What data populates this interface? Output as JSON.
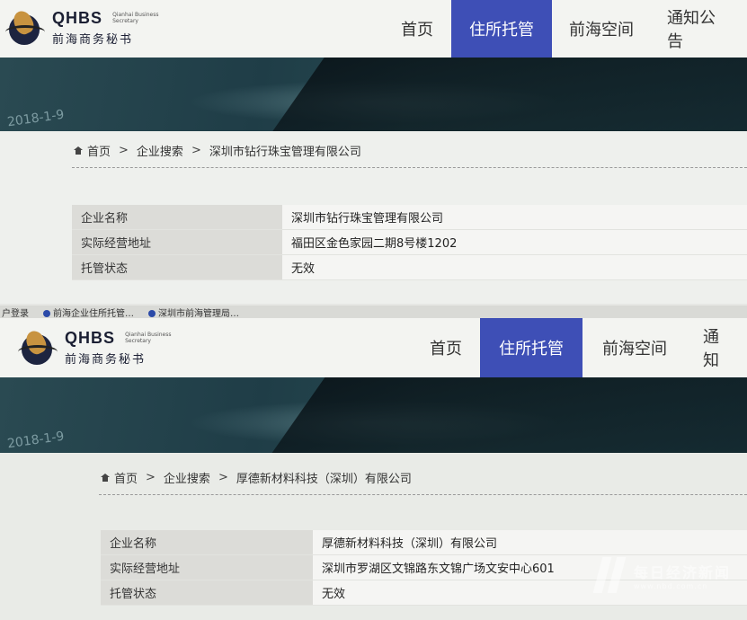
{
  "logo": {
    "main": "QHBS",
    "en": "Qianhai Business Secretary",
    "cn": "前海商务秘书"
  },
  "nav": {
    "home": "首页",
    "residence": "住所托管",
    "space": "前海空间",
    "notice_top": "通知公告",
    "notice_bottom": "通知"
  },
  "banner": {
    "scrawl": "2018-1-9"
  },
  "bookmarks": {
    "items": [
      "户登录",
      "前海企业住所托管…",
      "深圳市前海管理局…"
    ]
  },
  "top": {
    "breadcrumb": {
      "home": "首页",
      "search": "企业搜索",
      "current": "深圳市钻行珠宝管理有限公司"
    },
    "fields": [
      {
        "key": "企业名称",
        "value": "深圳市钻行珠宝管理有限公司"
      },
      {
        "key": "实际经营地址",
        "value": "福田区金色家园二期8号楼1202"
      },
      {
        "key": "托管状态",
        "value": "无效"
      }
    ]
  },
  "bottom": {
    "breadcrumb": {
      "home": "首页",
      "search": "企业搜索",
      "current": "厚德新材料科技（深圳）有限公司"
    },
    "fields": [
      {
        "key": "企业名称",
        "value": "厚德新材料科技（深圳）有限公司"
      },
      {
        "key": "实际经营地址",
        "value": "深圳市罗湖区文锦路东文锦广场文安中心601"
      },
      {
        "key": "托管状态",
        "value": "无效"
      }
    ]
  },
  "watermark": {
    "cn": "每日经济新闻",
    "en": "www.nbd.com.cn"
  },
  "colors": {
    "nav_active": "#3e4fb6",
    "banner": "#1f3d47"
  }
}
